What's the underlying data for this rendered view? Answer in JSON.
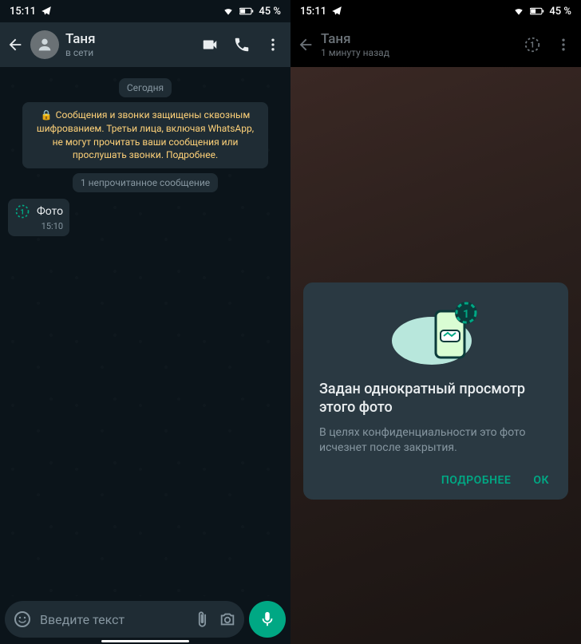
{
  "status": {
    "time": "15:11",
    "battery": "45 %"
  },
  "left": {
    "contact_name": "Таня",
    "status": "в сети",
    "date_label": "Сегодня",
    "encryption_text": "Сообщения и звонки защищены сквозным шифрованием. Третьи лица, включая WhatsApp, не могут прочитать ваши сообщения или прослушать звонки. Подробнее.",
    "unread_label": "1 непрочитанное сообщение",
    "message_label": "Фото",
    "message_time": "15:10",
    "input_placeholder": "Введите текст"
  },
  "right": {
    "contact_name": "Таня",
    "status": "1 минуту назад",
    "dialog_title": "Задан однократный просмотр этого фото",
    "dialog_body": "В целях конфиденциальности это фото исчезнет после закрытия.",
    "learn_more": "ПОДРОБНЕЕ",
    "ok": "ОК"
  }
}
